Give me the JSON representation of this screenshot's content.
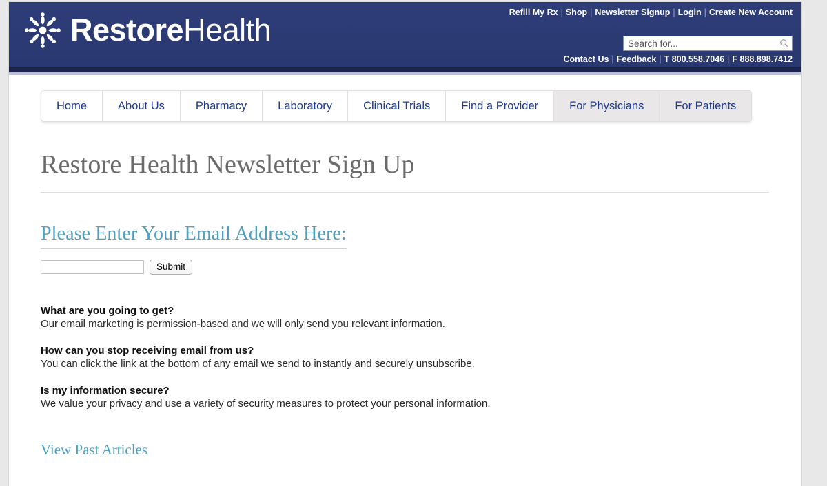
{
  "brand": {
    "logo_icon": "starburst-snowflake-icon",
    "name_bold": "Restore",
    "name_light": "Health"
  },
  "header": {
    "utility_links": [
      "Refill My Rx",
      "Shop",
      "Newsletter Signup",
      "Login",
      "Create New Account"
    ],
    "separator": "|",
    "search": {
      "placeholder": "Search for...",
      "value": "",
      "icon": "search-icon"
    },
    "contact_links": [
      "Contact Us",
      "Feedback",
      "T 800.558.7046",
      "F 888.898.7412"
    ]
  },
  "nav": {
    "tabs": [
      {
        "label": "Home",
        "shaded": false
      },
      {
        "label": "About Us",
        "shaded": false
      },
      {
        "label": "Pharmacy",
        "shaded": false
      },
      {
        "label": "Laboratory",
        "shaded": false
      },
      {
        "label": "Clinical Trials",
        "shaded": false
      },
      {
        "label": "Find a Provider",
        "shaded": false
      },
      {
        "label": "For Physicians",
        "shaded": true
      },
      {
        "label": "For Patients",
        "shaded": true
      }
    ]
  },
  "main": {
    "page_title": "Restore Health Newsletter Sign Up",
    "form": {
      "heading": "Please Enter Your Email Address Here:",
      "email_value": "",
      "email_placeholder": "",
      "submit_label": "Submit"
    },
    "faq": [
      {
        "question": "What are you going to get?",
        "answer": "Our email marketing is permission-based and we will only send you relevant information."
      },
      {
        "question": "How can you stop receiving email from us?",
        "answer": "You can click the link at the bottom of any email we send to instantly and securely unsubscribe."
      },
      {
        "question": "Is my information secure?",
        "answer": "We value your privacy and use a variety of security measures to protect your personal information."
      }
    ],
    "past_articles_link": "View Past Articles"
  },
  "colors": {
    "header_navy": "#2b3a74",
    "header_rule_dark": "#1b234f",
    "header_rule_light": "#b9bfdb",
    "tab_text_blue": "#1f3a8a",
    "tab_shaded_bg": "#e9e7e8",
    "title_gray": "#6b6b6b",
    "accent_teal": "#4f9fc0",
    "page_bg": "#e8e8e8"
  }
}
